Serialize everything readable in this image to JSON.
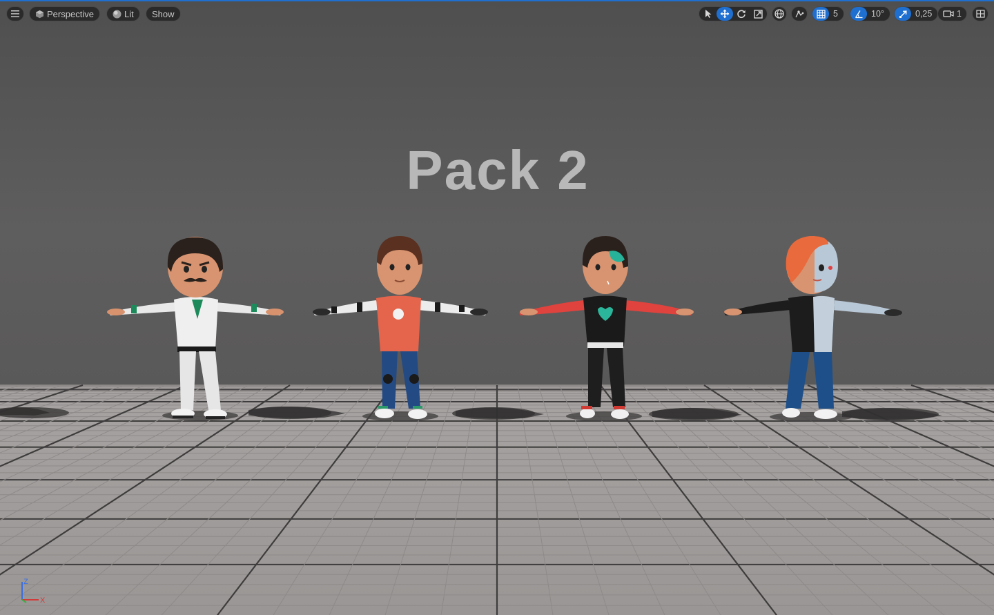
{
  "viewport": {
    "view_mode": "Perspective",
    "lighting_mode": "Lit",
    "show_label": "Show",
    "grid_snap_value": "5",
    "rotation_snap_value": "10°",
    "scale_snap_value": "0,25",
    "camera_speed_value": "1",
    "scene_text": "Pack 2",
    "accent_color": "#1f6fd1"
  },
  "axis_gizmo": {
    "z": "Z",
    "x": "X"
  },
  "icons": {
    "menu": "hamburger-icon",
    "perspective": "cube-icon",
    "lit": "sphere-icon",
    "select": "cursor-icon",
    "translate": "move-arrows-icon",
    "rotate": "rotate-icon",
    "scale": "scale-icon",
    "world": "globe-icon",
    "surface_snap": "surface-snap-icon",
    "grid_snap": "grid-icon",
    "rotation_snap": "angle-icon",
    "scale_snap": "scale-arrow-icon",
    "camera_speed": "camera-icon",
    "layout": "layout-grid-icon"
  }
}
